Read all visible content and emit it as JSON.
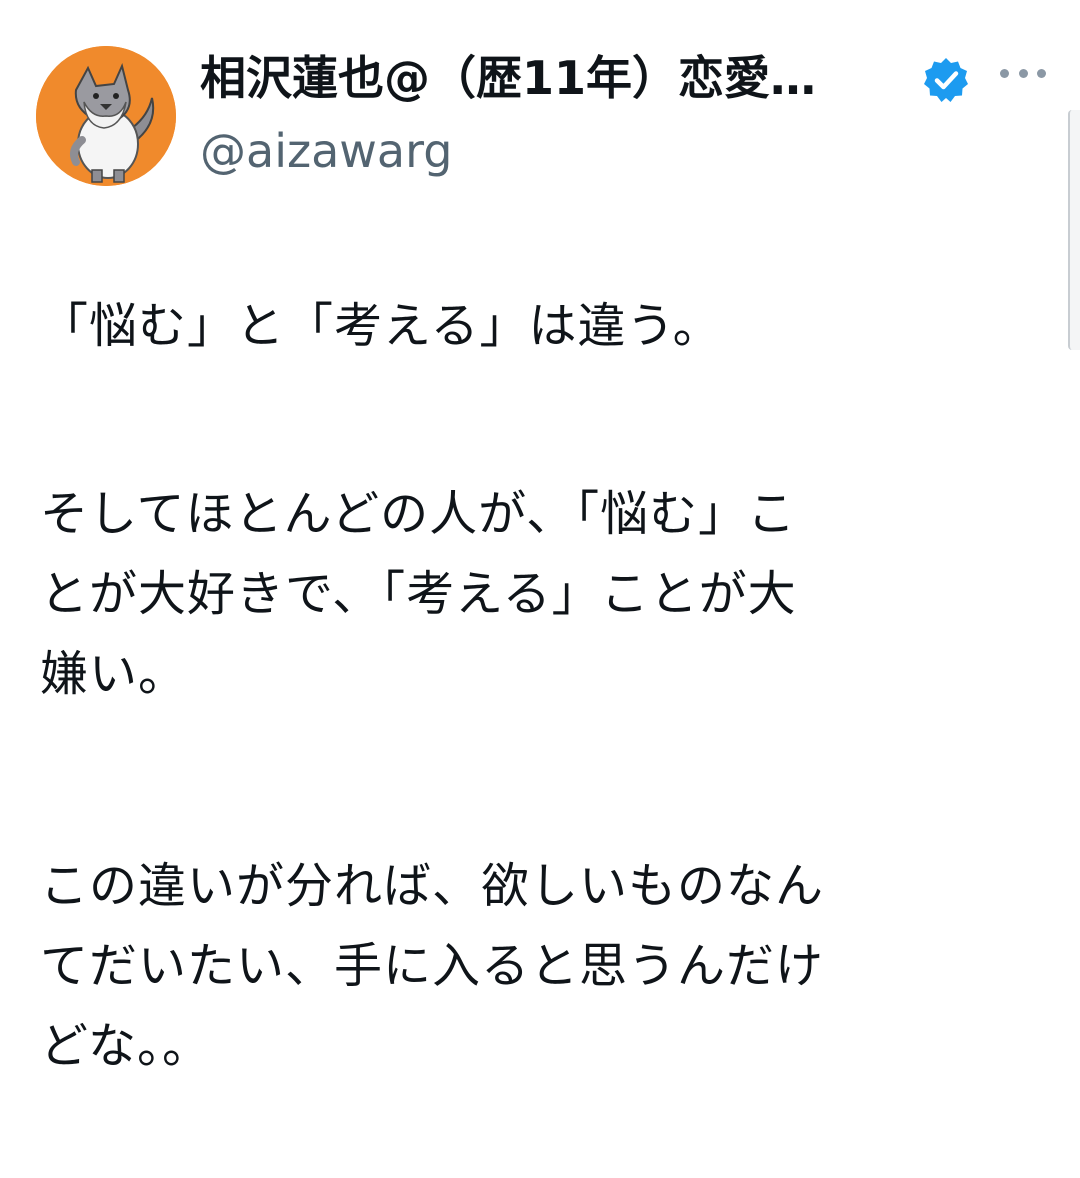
{
  "author": {
    "display_name": "相沢蓮也@（歴11年）恋愛…",
    "handle": "@aizawarg",
    "verified_icon": "verified-badge-icon",
    "more_icon": "more-options-icon",
    "avatar_colors": {
      "background": "#f08a2c",
      "badge": "#1d9bf0"
    }
  },
  "tweet": {
    "paragraph1": [
      "「悩む」と「考える」は違う。"
    ],
    "paragraph2": [
      "そしてほとんどの人が、「悩む」こ",
      "とが大好きで、「考える」ことが大",
      "嫌い。"
    ],
    "paragraph3": [
      "この違いが分れば、欲しいものなん",
      "てだいたい、手に入ると思うんだけ",
      "どな。。"
    ]
  }
}
